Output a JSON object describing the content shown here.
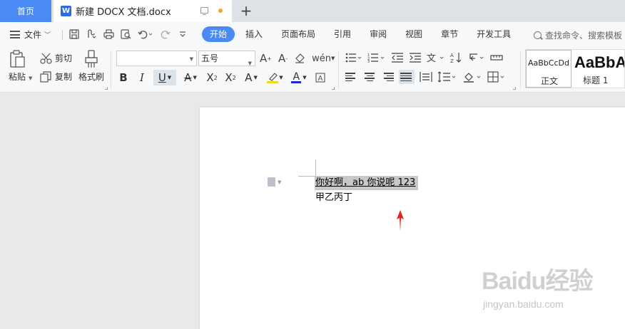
{
  "tabs": {
    "home": "首页",
    "document": "新建 DOCX 文档.docx",
    "doc_icon_letter": "W",
    "new_tab": "+"
  },
  "menu": {
    "file": "文件",
    "items": [
      "开始",
      "插入",
      "页面布局",
      "引用",
      "审阅",
      "视图",
      "章节",
      "开发工具"
    ],
    "active_item": "开始",
    "search_placeholder": "查找命令、搜索模板"
  },
  "ribbon": {
    "paste": "粘贴",
    "cut": "剪切",
    "copy": "复制",
    "format_painter": "格式刷",
    "font_name": "",
    "font_size": "五号",
    "styles": {
      "normal_preview": "AaBbCcDd",
      "normal_name": "正文",
      "heading1_preview": "AaBbA",
      "heading1_name": "标题 1"
    }
  },
  "document": {
    "line1": "你好啊，ab 你说呢 123",
    "line2": "甲乙丙丁"
  },
  "watermark": {
    "logo": "Baidu经验",
    "url": "jingyan.baidu.com"
  },
  "colors": {
    "accent": "#4a8af4",
    "selection": "#c8c8c8",
    "arrow": "#e8201c",
    "highlight_yellow": "#f5d90a",
    "font_color_blue": "#1a2bd8"
  }
}
